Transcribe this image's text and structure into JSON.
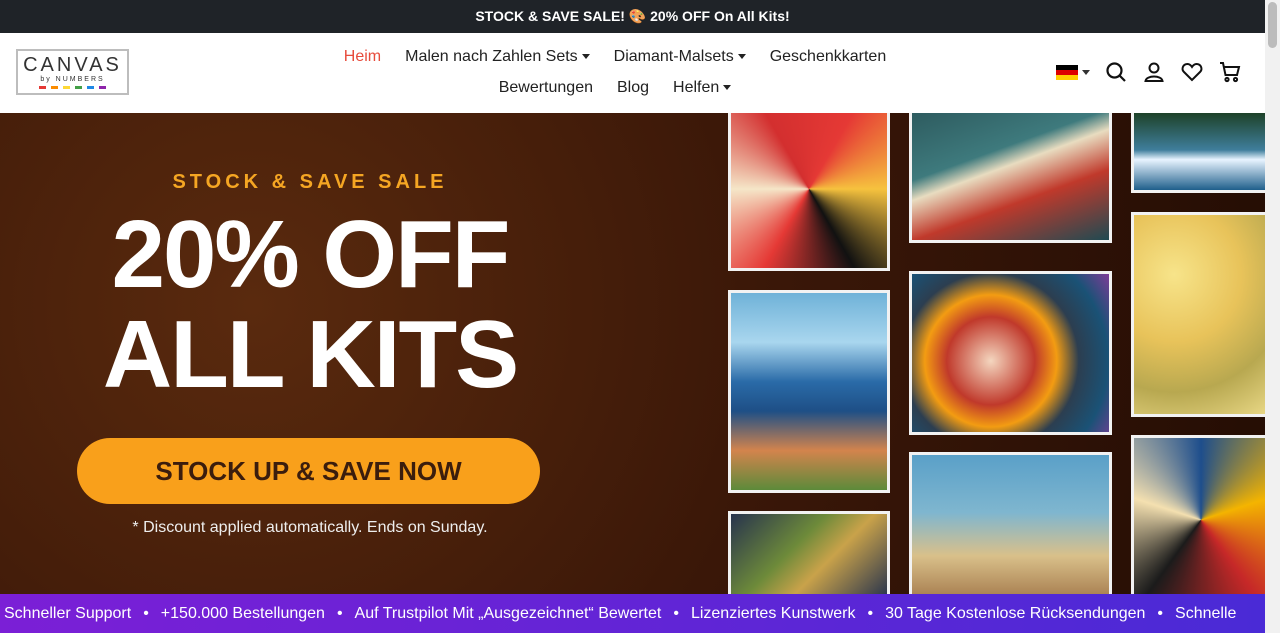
{
  "announcement": "STOCK & SAVE SALE! 🎨 20% OFF On All Kits!",
  "logo": {
    "main": "CANVAS",
    "sub": "by NUMBERS",
    "dots": [
      "#e53935",
      "#fb8c00",
      "#fdd835",
      "#43a047",
      "#1e88e5",
      "#8e24aa"
    ]
  },
  "nav": {
    "row1": [
      {
        "label": "Heim",
        "active": true
      },
      {
        "label": "Malen nach Zahlen Sets",
        "dropdown": true
      },
      {
        "label": "Diamant-Malsets",
        "dropdown": true
      },
      {
        "label": "Geschenkkarten"
      }
    ],
    "row2": [
      {
        "label": "Bewertungen"
      },
      {
        "label": "Blog"
      },
      {
        "label": "Helfen",
        "dropdown": true
      }
    ]
  },
  "header_icons": [
    "germany-flag-icon",
    "search-icon",
    "account-icon",
    "heart-icon",
    "cart-icon"
  ],
  "hero": {
    "eyebrow": "STOCK & SAVE SALE",
    "line1": "20% OFF",
    "line2": "ALL KITS",
    "cta": "STOCK UP & SAVE NOW",
    "note": "* Discount applied automatically. Ends on Sunday."
  },
  "ticker": [
    "Schneller Support",
    "+150.000 Bestellungen",
    "Auf Trustpilot Mit „Ausgezeichnet“ Bewertet",
    "Lizenziertes Kunstwerk",
    "30 Tage Kostenlose Rücksendungen",
    "Schnelle"
  ],
  "colors": {
    "accent": "#e74c3c",
    "cta": "#f9a01b",
    "eyebrow": "#f5a623"
  }
}
